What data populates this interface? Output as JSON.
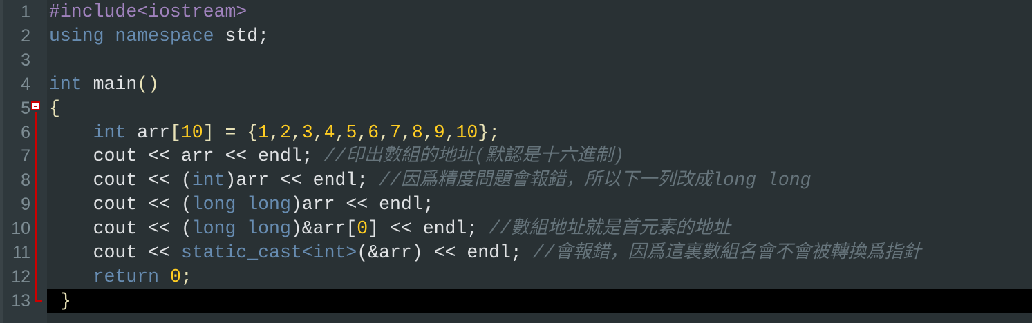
{
  "editor": {
    "current_line": 13,
    "colors": {
      "preprocessor": "#a082bd",
      "keyword": "#678cb1",
      "text": "#e0e2e4",
      "number": "#ffcd22",
      "operator": "#e8e2b7",
      "comment": "#66747b",
      "current_line_bg": "#000000"
    },
    "fold_marker_icon": "fold-minus-icon",
    "lines": [
      {
        "n": "1",
        "tokens": [
          {
            "t": "#include<iostream>",
            "c": "pp"
          }
        ]
      },
      {
        "n": "2",
        "tokens": [
          {
            "t": "using namespace ",
            "c": "kw"
          },
          {
            "t": "std;",
            "c": "tx"
          }
        ]
      },
      {
        "n": "3",
        "tokens": []
      },
      {
        "n": "4",
        "tokens": [
          {
            "t": "int ",
            "c": "kw"
          },
          {
            "t": "main",
            "c": "tx"
          },
          {
            "t": "()",
            "c": "op"
          }
        ]
      },
      {
        "n": "5",
        "tokens": [
          {
            "t": "{",
            "c": "op"
          }
        ]
      },
      {
        "n": "6",
        "tokens": [
          {
            "t": "    ",
            "c": "tx"
          },
          {
            "t": "int ",
            "c": "kw"
          },
          {
            "t": "arr",
            "c": "tx"
          },
          {
            "t": "[",
            "c": "op"
          },
          {
            "t": "10",
            "c": "num"
          },
          {
            "t": "] = {",
            "c": "op"
          },
          {
            "t": "1",
            "c": "num"
          },
          {
            "t": ",",
            "c": "op"
          },
          {
            "t": "2",
            "c": "num"
          },
          {
            "t": ",",
            "c": "op"
          },
          {
            "t": "3",
            "c": "num"
          },
          {
            "t": ",",
            "c": "op"
          },
          {
            "t": "4",
            "c": "num"
          },
          {
            "t": ",",
            "c": "op"
          },
          {
            "t": "5",
            "c": "num"
          },
          {
            "t": ",",
            "c": "op"
          },
          {
            "t": "6",
            "c": "num"
          },
          {
            "t": ",",
            "c": "op"
          },
          {
            "t": "7",
            "c": "num"
          },
          {
            "t": ",",
            "c": "op"
          },
          {
            "t": "8",
            "c": "num"
          },
          {
            "t": ",",
            "c": "op"
          },
          {
            "t": "9",
            "c": "num"
          },
          {
            "t": ",",
            "c": "op"
          },
          {
            "t": "10",
            "c": "num"
          },
          {
            "t": "};",
            "c": "op"
          }
        ]
      },
      {
        "n": "7",
        "tokens": [
          {
            "t": "    cout << arr << endl; ",
            "c": "tx"
          },
          {
            "t": "//印出數組的地址(默認是十六進制)",
            "c": "cm"
          }
        ]
      },
      {
        "n": "8",
        "tokens": [
          {
            "t": "    cout << (",
            "c": "tx"
          },
          {
            "t": "int",
            "c": "kw"
          },
          {
            "t": ")arr << endl; ",
            "c": "tx"
          },
          {
            "t": "//因爲精度問題會報錯，所以下一列改成long long",
            "c": "cm"
          }
        ]
      },
      {
        "n": "9",
        "tokens": [
          {
            "t": "    cout << (",
            "c": "tx"
          },
          {
            "t": "long long",
            "c": "kw"
          },
          {
            "t": ")arr << endl;",
            "c": "tx"
          }
        ]
      },
      {
        "n": "10",
        "tokens": [
          {
            "t": "    cout << (",
            "c": "tx"
          },
          {
            "t": "long long",
            "c": "kw"
          },
          {
            "t": ")&arr[",
            "c": "tx"
          },
          {
            "t": "0",
            "c": "num"
          },
          {
            "t": "] << endl; ",
            "c": "tx"
          },
          {
            "t": "//數組地址就是首元素的地址",
            "c": "cm"
          }
        ]
      },
      {
        "n": "11",
        "tokens": [
          {
            "t": "    cout << ",
            "c": "tx"
          },
          {
            "t": "static_cast<int>",
            "c": "kw"
          },
          {
            "t": "(&arr) << endl; ",
            "c": "tx"
          },
          {
            "t": "//會報錯，因爲這裏數組名會不會被轉換爲指針",
            "c": "cm"
          }
        ]
      },
      {
        "n": "12",
        "tokens": [
          {
            "t": "    ",
            "c": "tx"
          },
          {
            "t": "return ",
            "c": "kw"
          },
          {
            "t": "0",
            "c": "num"
          },
          {
            "t": ";",
            "c": "op"
          }
        ]
      },
      {
        "n": "13",
        "tokens": [
          {
            "t": " }",
            "c": "op"
          }
        ]
      }
    ]
  }
}
